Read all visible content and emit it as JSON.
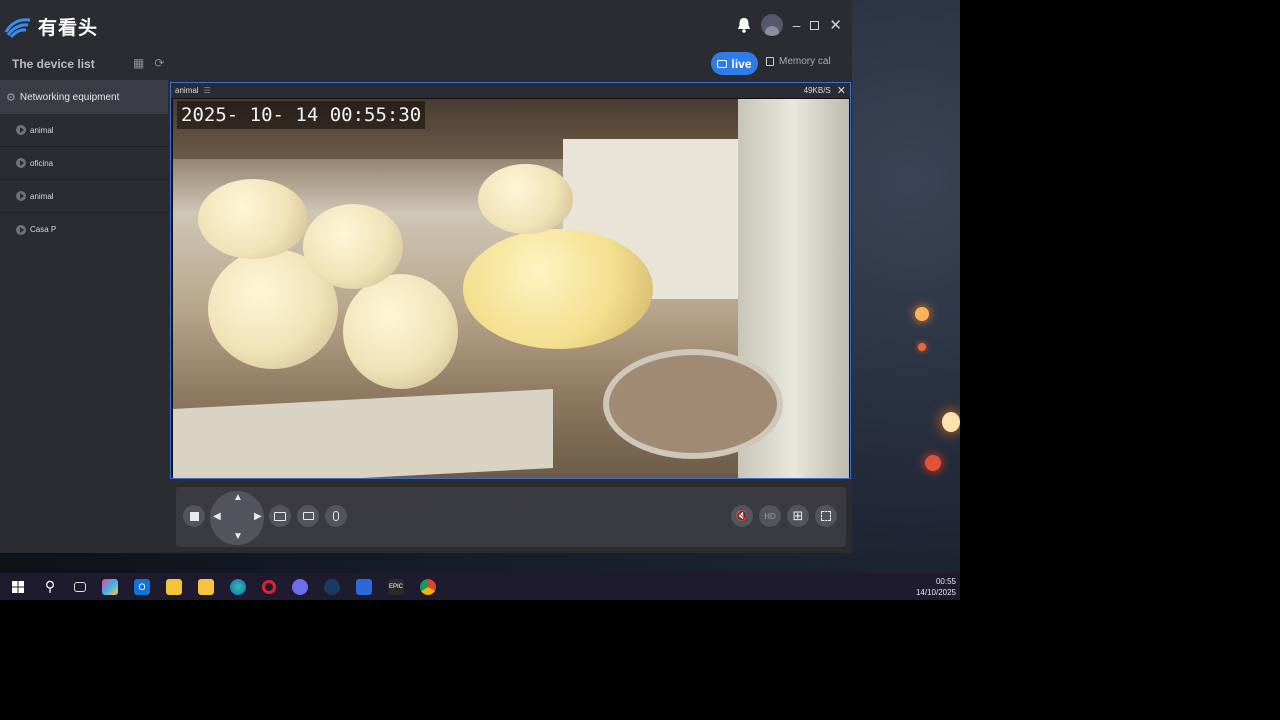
{
  "app": {
    "logo_text": "有看头",
    "window_controls": [
      "bell-icon",
      "avatar",
      "minimize-icon",
      "maximize-icon",
      "close-icon"
    ]
  },
  "toolbar": {
    "device_list_title": "The device list",
    "live_label": "live",
    "memory_tab_label": "Memory cal"
  },
  "sidebar": {
    "group_label": "Networking equipment",
    "devices": [
      {
        "label": "animal"
      },
      {
        "label": "oficina"
      },
      {
        "label": "animal"
      },
      {
        "label": "Casa P"
      }
    ]
  },
  "video": {
    "channel_name": "animal",
    "bitrate": "49KB/S",
    "osd_timestamp": "2025- 10- 14   00:55:30"
  },
  "controls": {
    "left": [
      "stop-icon",
      "ptz-dpad",
      "snapshot-icon",
      "record-icon",
      "mic-icon"
    ],
    "right": [
      "mute-icon",
      "hd-toggle",
      "grid-layout-icon",
      "fullscreen-icon"
    ],
    "hd_label": "HD"
  },
  "taskbar": {
    "icons": [
      "windows-start-icon",
      "search-icon",
      "task-view-icon",
      "copilot-icon",
      "outlook-icon",
      "store-icon",
      "file-explorer-icon",
      "edge-icon",
      "opera-icon",
      "discord-icon",
      "steam-icon",
      "camera-app-icon",
      "epic-games-icon",
      "chrome-icon"
    ],
    "time": "00:55",
    "date": "14/10/2025"
  },
  "colors": {
    "accent": "#2f7be8",
    "app_bg": "#2b2c31",
    "selected_row": "#3b3d44"
  }
}
